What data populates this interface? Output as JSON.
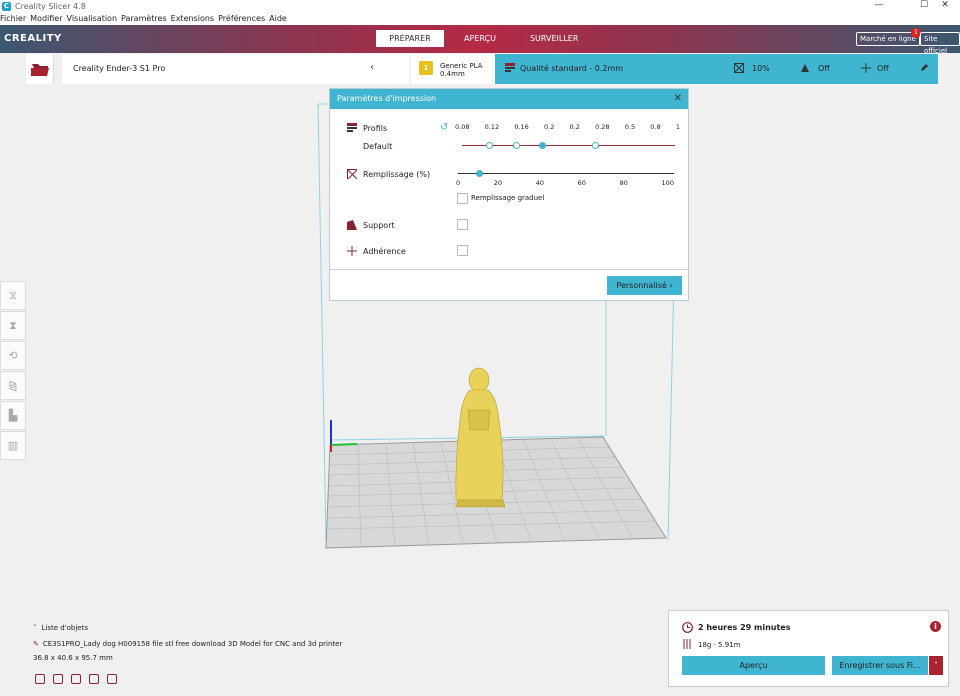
{
  "window": {
    "title": "Creality Slicer 4.8",
    "app_icon": "C",
    "minimize": "—",
    "maximize": "☐",
    "close": "✕"
  },
  "menu": [
    "Fichier",
    "Modifier",
    "Visualisation",
    "Paramètres",
    "Extensions",
    "Préférences",
    "Aide"
  ],
  "header": {
    "logo": "CREALITY",
    "tabs": [
      "PRÉPARER",
      "APERÇU",
      "SURVEILLER"
    ],
    "marketplace": "Marché en ligne",
    "marketplace_badge": "1",
    "official_site": "Site officiel"
  },
  "toolbar": {
    "printer": "Creality Ender-3 S1 Pro",
    "material_name": "Generic PLA",
    "material_nozzle": "0.4mm",
    "material_badge": "1",
    "profile": "Qualité standard - 0.2mm",
    "infill": "10%",
    "support": "Off",
    "adhesion": "Off"
  },
  "panel": {
    "title": "Paramètres d'impression",
    "profiles_label": "Profils",
    "profiles_default": "Default",
    "layer_values": [
      "0.08",
      "0.12",
      "0.16",
      "0.2",
      "0.2",
      "0.28",
      "0.5",
      "0.8",
      "1"
    ],
    "selected_layer": "0.2",
    "infill_label": "Remplissage (%)",
    "infill_ticks": [
      "0",
      "20",
      "40",
      "60",
      "80",
      "100"
    ],
    "infill_value": 10,
    "gradual_infill": "Remplissage graduel",
    "support_label": "Support",
    "adhesion_label": "Adhérence",
    "custom_button": "Personnalisé"
  },
  "objects": {
    "list_label": "Liste d'objets",
    "file_name": "CE3S1PRO_Lady dog H009158 file stl free download 3D Model for CNC and 3d printer",
    "dimensions": "36.8 x 40.6 x 95.7 mm"
  },
  "action": {
    "time": "2 heures 29 minutes",
    "material": "18g · 5.91m",
    "preview_button": "Aperçu",
    "save_button": "Enregistrer sous Fi...",
    "info": "i"
  },
  "colors": {
    "accent": "#3fb5d1",
    "brand_red": "#a8222f",
    "model": "#e8d25a"
  }
}
